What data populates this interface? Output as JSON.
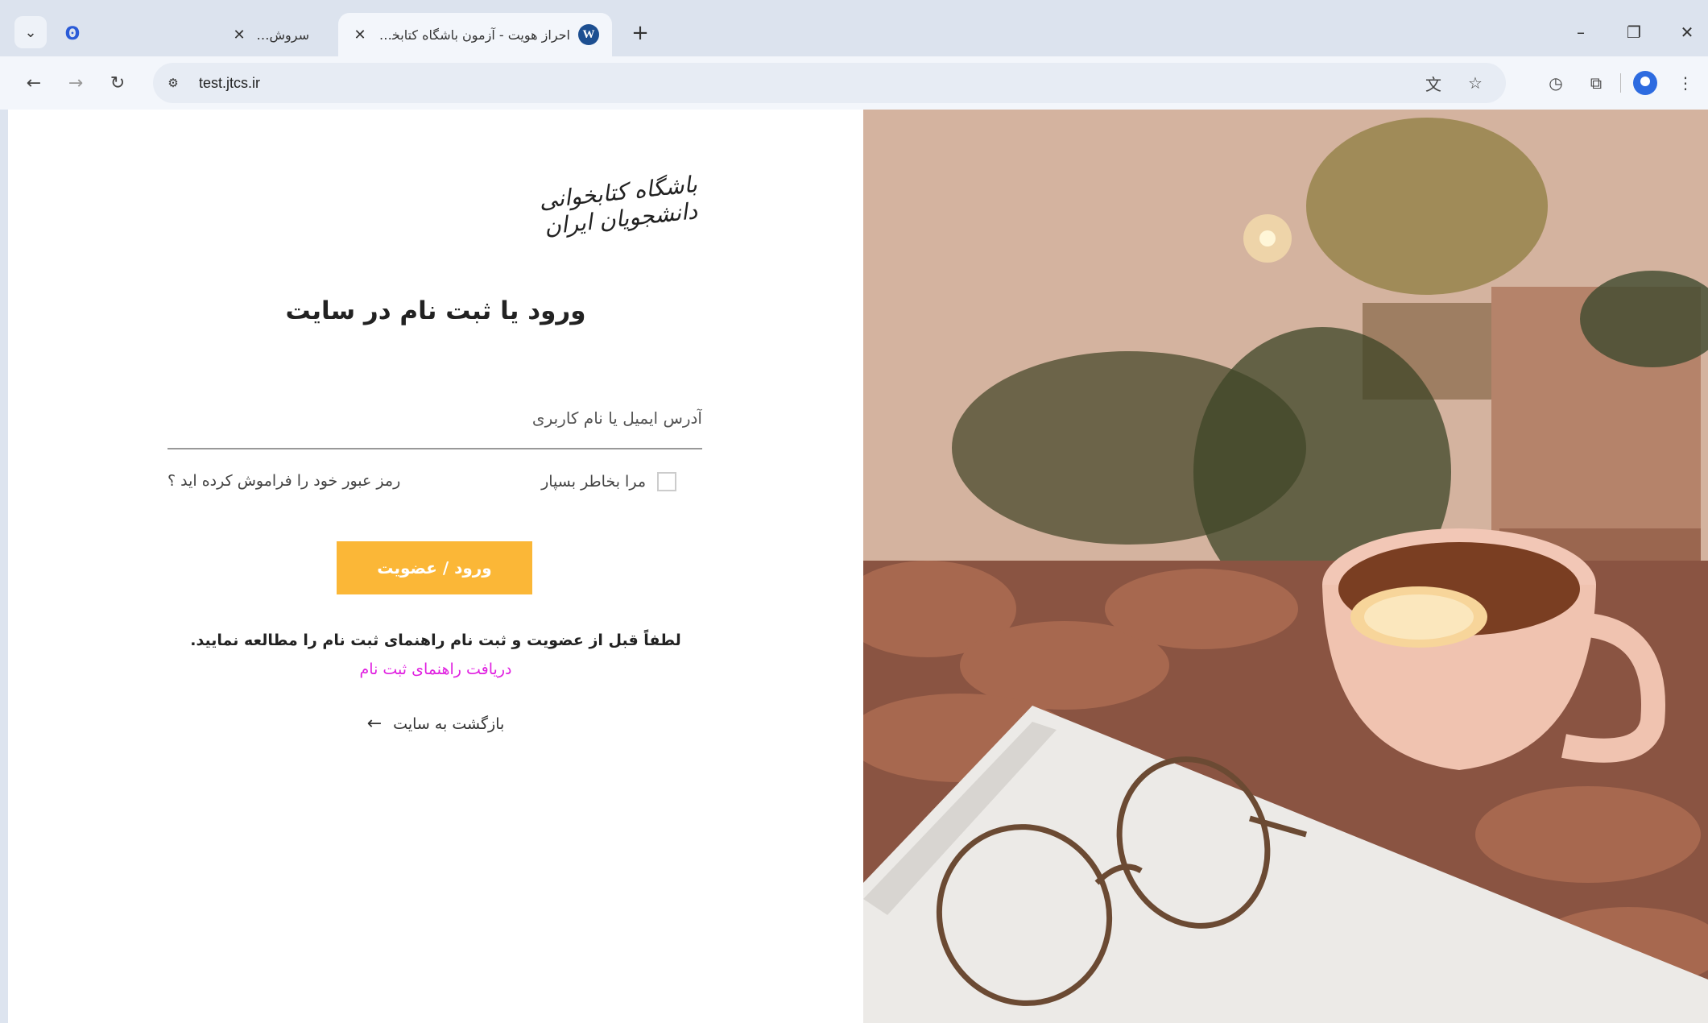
{
  "browser": {
    "tabs": [
      {
        "title": "سروش پلاس",
        "close": "✕"
      },
      {
        "title": "احراز هویت - آزمون باشگاه کتابخوانی د",
        "close": "✕"
      }
    ],
    "new_tab": "+",
    "url": "test.jtcs.ir"
  },
  "page": {
    "logo_text": "باشگاه کتابخوانی دانشجویان ایران",
    "title": "ورود یا ثبت نام در سایت",
    "username_placeholder": "آدرس ایمیل یا نام کاربری",
    "remember_label": "مرا بخاطر بسپار",
    "forgot_label": "رمز عبور خود را فراموش کرده اید ؟",
    "submit_label": "ورود / عضویت",
    "note": "لطفاً قبل از عضویت و ثبت نام راهنمای ثبت نام را مطالعه نمایید.",
    "guide_link": "دریافت راهنمای ثبت نام",
    "back_label": "بازگشت به سایت",
    "back_arrow": "←"
  },
  "colors": {
    "accent": "#fbb737",
    "link": "#e01fe0"
  }
}
